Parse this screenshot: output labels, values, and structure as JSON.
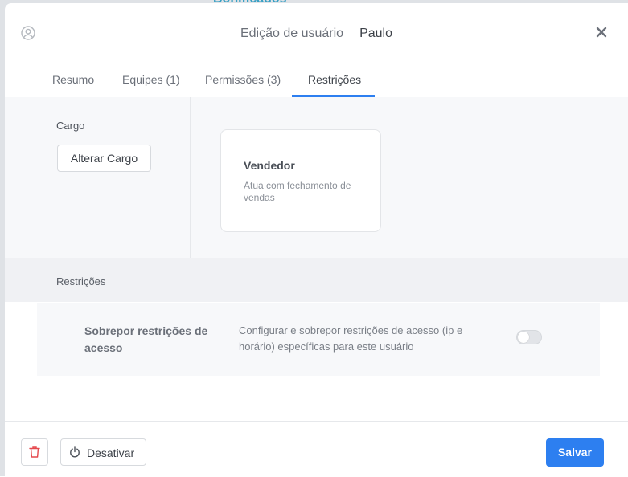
{
  "background": {
    "title": "Bonificados"
  },
  "header": {
    "title": "Edição de usuário",
    "user_name": "Paulo"
  },
  "tabs": [
    {
      "label": "Resumo"
    },
    {
      "label": "Equipes (1)"
    },
    {
      "label": "Permissões (3)"
    },
    {
      "label": "Restrições",
      "active": true
    }
  ],
  "cargo": {
    "section_label": "Cargo",
    "change_button": "Alterar Cargo",
    "role": {
      "name": "Vendedor",
      "description": "Atua com fechamento de vendas"
    }
  },
  "restrictions": {
    "section_label": "Restrições",
    "override": {
      "title": "Sobrepor restrições de acesso",
      "description": "Configurar e sobrepor restrições de acesso (ip e horário) específicas para este usuário",
      "enabled": false
    }
  },
  "footer": {
    "deactivate_label": "Desativar",
    "save_label": "Salvar"
  },
  "colors": {
    "accent": "#2d7ff0",
    "danger": "#e5484d"
  }
}
